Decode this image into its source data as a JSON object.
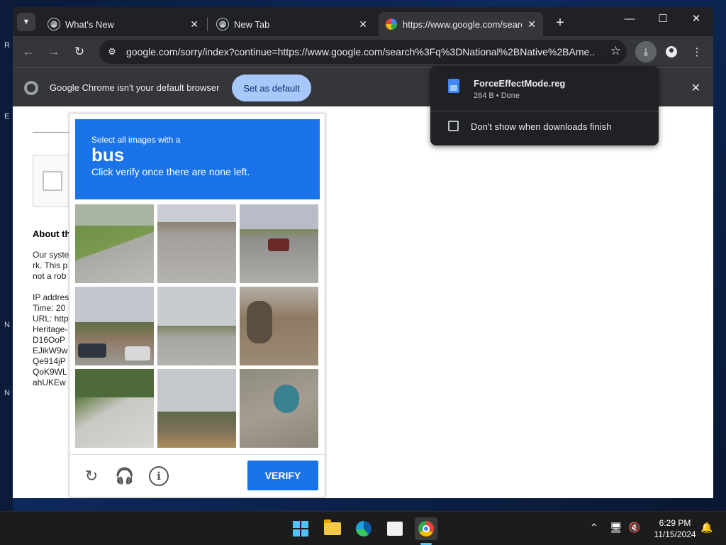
{
  "desktop": {
    "edge_letters": [
      "R",
      "E",
      "N",
      "N"
    ]
  },
  "browser": {
    "tabs": [
      {
        "label": "What's New",
        "close": "✕"
      },
      {
        "label": "New Tab",
        "close": "✕"
      },
      {
        "label": "https://www.google.com/search",
        "close": "✕"
      }
    ],
    "new_tab": "+",
    "window_controls": {
      "minimize": "—",
      "maximize": "☐",
      "close": "✕"
    },
    "url": "google.com/sorry/index?continue=https://www.google.com/search%3Fq%3DNational%2BNative%2BAme...",
    "infobar": {
      "message": "Google Chrome isn't your default browser",
      "button": "Set as default",
      "close": "✕"
    }
  },
  "page": {
    "about_heading": "About th",
    "text_lines": [
      "Our syste",
      "rk. This p",
      "not a rob",
      "",
      "IP addres",
      "Time: 20",
      "URL: http",
      "Heritage-",
      "D16OoP",
      "EJikW9w",
      "Qe914jP",
      "QoK9WL",
      "ahUKEw"
    ]
  },
  "captcha": {
    "instruction_small": "Select all images with a",
    "target": "bus",
    "instruction_sub": "Click verify once there are none left.",
    "verify_label": "VERIFY",
    "icons": [
      "reload-icon",
      "headphones-icon",
      "info-icon"
    ]
  },
  "downloads": {
    "file_name": "ForceEffectMode.reg",
    "status": "264 B • Done",
    "checkbox_label": "Don't show when downloads finish"
  },
  "taskbar": {
    "time": "6:29 PM",
    "date": "11/15/2024"
  }
}
